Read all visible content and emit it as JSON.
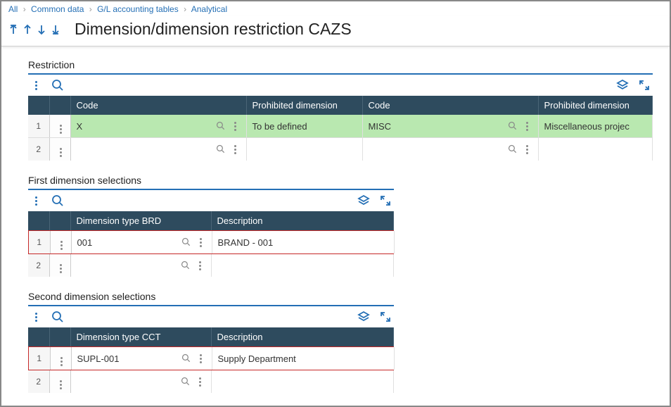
{
  "breadcrumb": {
    "all": "All",
    "common": "Common data",
    "gl": "G/L accounting tables",
    "analytical": "Analytical"
  },
  "title": "Dimension/dimension restriction CAZS",
  "restriction": {
    "title": "Restriction",
    "headers": {
      "code1": "Code",
      "prohib1": "Prohibited dimension",
      "code2": "Code",
      "prohib2": "Prohibited dimension"
    },
    "rows": [
      {
        "n": "1",
        "code1": "X",
        "prohib1": "To be defined",
        "code2": "MISC",
        "prohib2": "Miscellaneous projec",
        "hl": true
      },
      {
        "n": "2",
        "code1": "",
        "prohib1": "",
        "code2": "",
        "prohib2": "",
        "hl": false
      }
    ]
  },
  "first_dim": {
    "title": "First dimension selections",
    "headers": {
      "dim": "Dimension type BRD",
      "desc": "Description"
    },
    "rows": [
      {
        "n": "1",
        "dim": "001",
        "desc": "BRAND - 001",
        "red": true
      },
      {
        "n": "2",
        "dim": "",
        "desc": "",
        "red": false
      }
    ]
  },
  "second_dim": {
    "title": "Second dimension selections",
    "headers": {
      "dim": "Dimension type CCT",
      "desc": "Description"
    },
    "rows": [
      {
        "n": "1",
        "dim": "SUPL-001",
        "desc": "Supply Department",
        "red": true
      },
      {
        "n": "2",
        "dim": "",
        "desc": "",
        "red": false
      }
    ]
  }
}
